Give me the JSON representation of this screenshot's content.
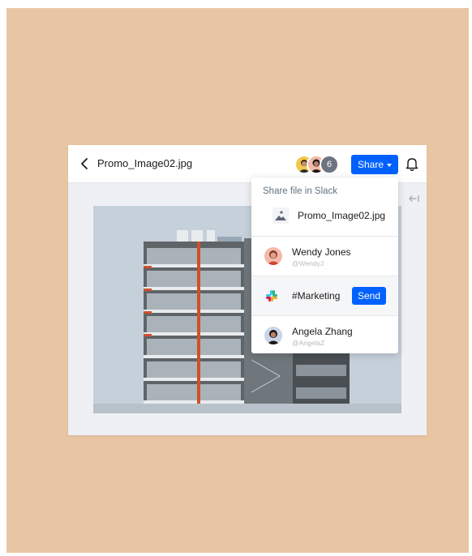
{
  "topbar": {
    "filename": "Promo_Image02.jpg",
    "avatar_count": "6",
    "share_label": "Share"
  },
  "share_menu": {
    "title": "Share file in Slack",
    "file_name": "Promo_Image02.jpg",
    "people": [
      {
        "name": "Wendy Jones",
        "handle": "@WendyJ"
      },
      {
        "name": "Angela Zhang",
        "handle": "@AngelaZ"
      }
    ],
    "channel": {
      "name": "#Marketing",
      "send_label": "Send"
    }
  },
  "icons": [
    "back-chevron-icon",
    "bell-icon",
    "collapse-arrow-icon",
    "image-file-icon",
    "slack-icon"
  ],
  "colors": {
    "background": "#e8c5a3",
    "accent": "#0061fe",
    "panel": "#eef0f5"
  }
}
